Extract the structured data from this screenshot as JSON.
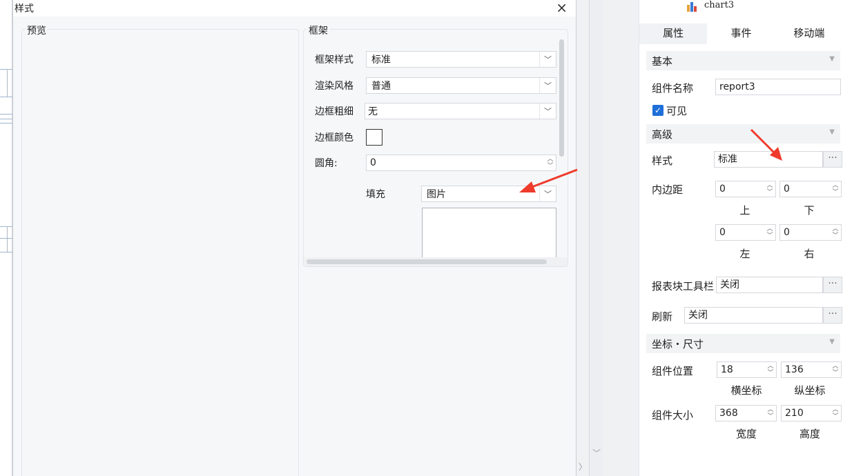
{
  "dialog": {
    "title": "样式",
    "close": "×",
    "preview_label": "预览",
    "frame_label": "框架",
    "rows": {
      "frame_style": {
        "label": "框架样式",
        "value": "标准"
      },
      "render_style": {
        "label": "渲染风格",
        "value": "普通"
      },
      "border_width": {
        "label": "边框粗细",
        "value": "无"
      },
      "border_color": {
        "label": "边框颜色"
      },
      "radius": {
        "label": "圆角:",
        "value": "0"
      },
      "fill": {
        "label": "填充",
        "value": "图片"
      }
    }
  },
  "panel": {
    "component": "chart3",
    "tabs": [
      "属性",
      "事件",
      "移动端"
    ],
    "basic": {
      "title": "基本",
      "name_label": "组件名称",
      "name_value": "report3",
      "visible_label": "可见"
    },
    "advanced": {
      "title": "高级",
      "style_label": "样式",
      "style_value": "标准",
      "padding_label": "内边距",
      "top": "0",
      "bottom": "0",
      "left": "0",
      "right": "0",
      "top_label": "上",
      "bottom_label": "下",
      "left_label": "左",
      "right_label": "右",
      "toolbar_label": "报表块工具栏",
      "toolbar_value": "关闭",
      "refresh_label": "刷新",
      "refresh_value": "关闭"
    },
    "coords": {
      "title": "坐标・尺寸",
      "pos_label": "组件位置",
      "x": "18",
      "y": "136",
      "x_label": "横坐标",
      "y_label": "纵坐标",
      "size_label": "组件大小",
      "w": "368",
      "h": "210",
      "w_label": "宽度",
      "h_label": "高度"
    },
    "ellipsis": "···"
  },
  "colors": {
    "accent": "#1f6fd8",
    "arrow": "#ee3b2c"
  }
}
